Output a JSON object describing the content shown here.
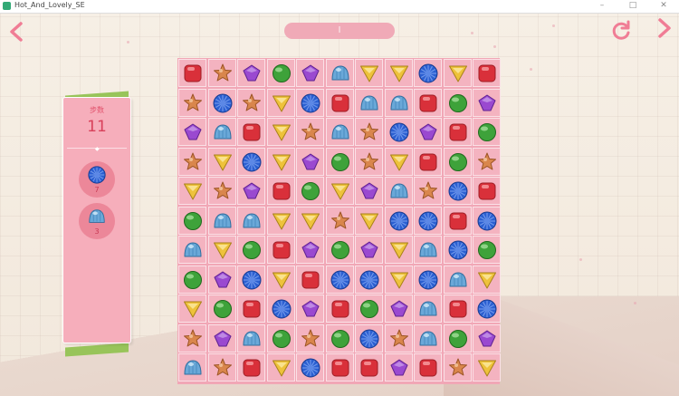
{
  "window": {
    "title": "Hot_And_Lovely_SE"
  },
  "level_bar": {
    "text": "l"
  },
  "sidebar": {
    "moves_label": "步数",
    "moves_value": "11",
    "goals": [
      {
        "icon": "blue-flower",
        "count": "7"
      },
      {
        "icon": "blue-dome",
        "count": "3"
      }
    ]
  },
  "legend": {
    "R": "red-square",
    "S": "orange-star",
    "P": "purple-diamond",
    "G": "green-circle",
    "B": "blue-dome",
    "F": "blue-flower",
    "Y": "yellow-triangle"
  },
  "board": {
    "rows": [
      [
        "R",
        "S",
        "P",
        "G",
        "P",
        "B",
        "Y",
        "Y",
        "F",
        "Y",
        "R"
      ],
      [
        "S",
        "F",
        "S",
        "Y",
        "F",
        "R",
        "B",
        "B",
        "R",
        "G",
        "P"
      ],
      [
        "P",
        "B",
        "R",
        "Y",
        "S",
        "B",
        "S",
        "F",
        "P",
        "R",
        "G"
      ],
      [
        "S",
        "Y",
        "F",
        "Y",
        "P",
        "G",
        "S",
        "Y",
        "R",
        "G",
        "S"
      ],
      [
        "Y",
        "S",
        "P",
        "R",
        "G",
        "Y",
        "P",
        "B",
        "S",
        "F",
        "R"
      ],
      [
        "G",
        "B",
        "B",
        "Y",
        "Y",
        "S",
        "Y",
        "F",
        "F",
        "R",
        "F"
      ],
      [
        "B",
        "Y",
        "G",
        "R",
        "P",
        "G",
        "P",
        "Y",
        "B",
        "F",
        "G"
      ],
      [
        "G",
        "P",
        "F",
        "Y",
        "R",
        "F",
        "F",
        "Y",
        "F",
        "B",
        "Y"
      ],
      [
        "Y",
        "G",
        "R",
        "F",
        "P",
        "R",
        "G",
        "P",
        "B",
        "R",
        "F"
      ],
      [
        "S",
        "P",
        "B",
        "G",
        "S",
        "G",
        "F",
        "S",
        "B",
        "G",
        "P"
      ],
      [
        "B",
        "S",
        "R",
        "Y",
        "F",
        "R",
        "R",
        "P",
        "R",
        "S",
        "Y"
      ]
    ]
  }
}
